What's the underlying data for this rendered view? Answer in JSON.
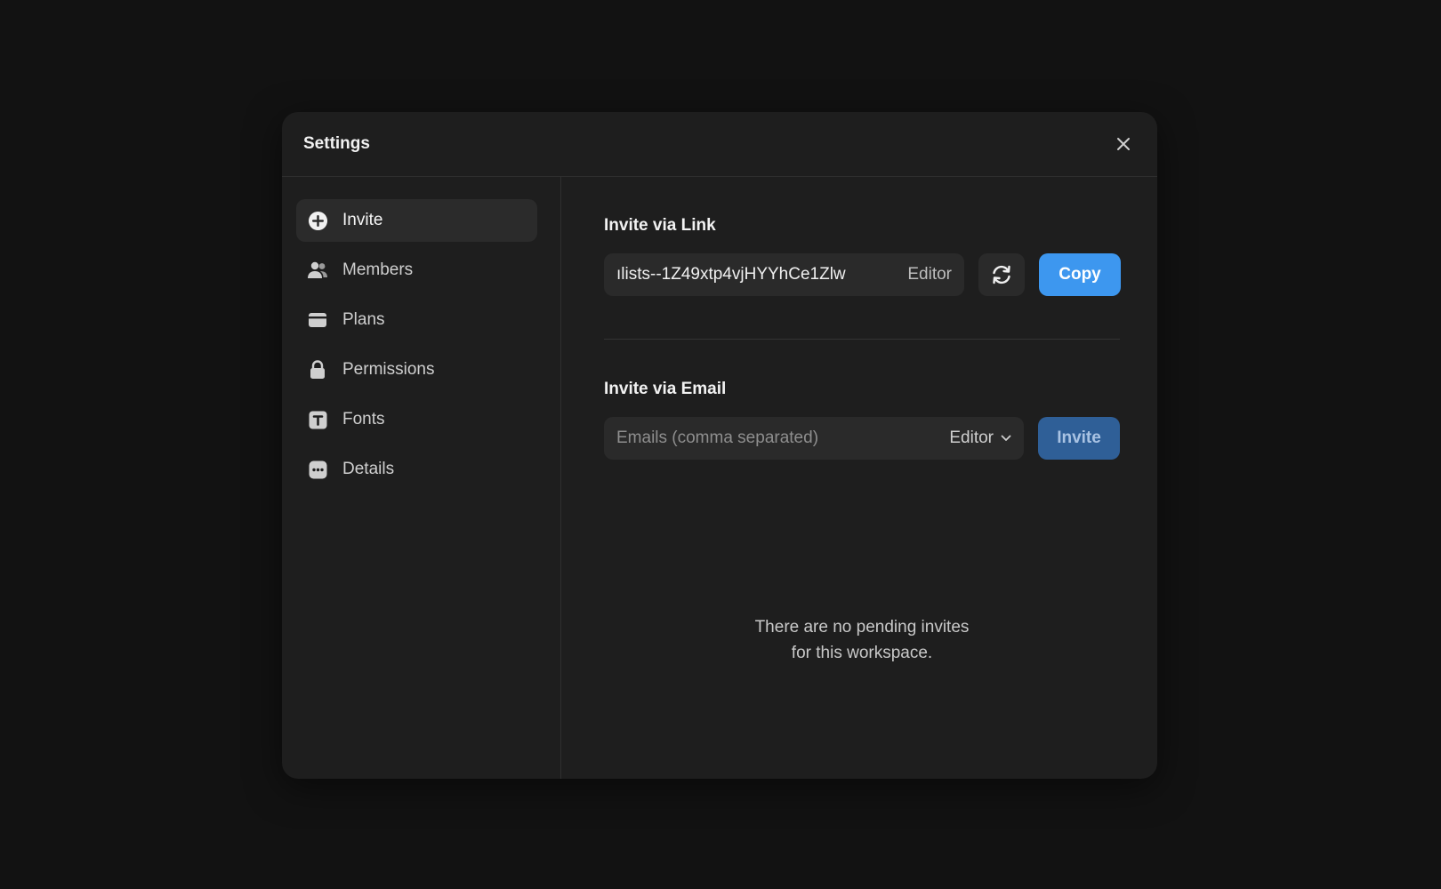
{
  "modal": {
    "title": "Settings"
  },
  "sidebar": {
    "items": [
      {
        "label": "Invite",
        "icon": "plus-circle-icon",
        "active": true
      },
      {
        "label": "Members",
        "icon": "users-icon"
      },
      {
        "label": "Plans",
        "icon": "credit-card-icon"
      },
      {
        "label": "Permissions",
        "icon": "lock-icon"
      },
      {
        "label": "Fonts",
        "icon": "font-icon"
      },
      {
        "label": "Details",
        "icon": "dots-icon"
      }
    ]
  },
  "invite_link": {
    "title": "Invite via Link",
    "url": "ılists--1Z49xtp4vjHYYhCe1Zlw",
    "role": "Editor",
    "copy_label": "Copy"
  },
  "invite_email": {
    "title": "Invite via Email",
    "placeholder": "Emails (comma separated)",
    "role": "Editor",
    "invite_label": "Invite"
  },
  "empty_state": {
    "line1": "There are no pending invites",
    "line2": "for this workspace."
  },
  "colors": {
    "background": "#121212",
    "modal": "#1e1e1e",
    "accent": "#3d97ef",
    "accent_disabled": "#2f5f97"
  }
}
